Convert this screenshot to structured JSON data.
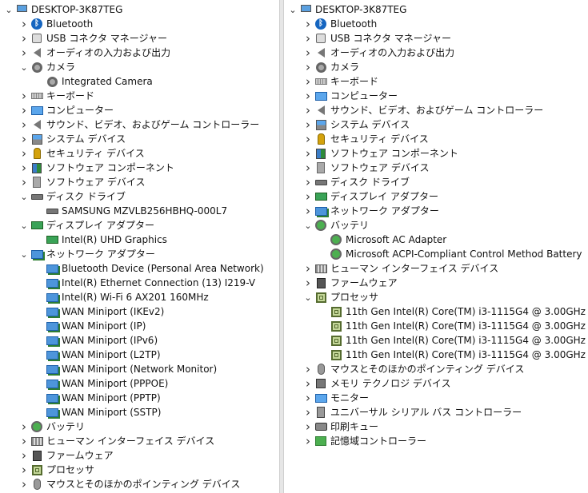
{
  "left": {
    "nodes": [
      {
        "label": "DESKTOP-3K87TEG",
        "depth": 0,
        "expander": "down",
        "icon": "computer-root-icon"
      },
      {
        "label": "Bluetooth",
        "depth": 1,
        "expander": "right",
        "icon": "bluetooth-icon"
      },
      {
        "label": "USB コネクタ マネージャー",
        "depth": 1,
        "expander": "right",
        "icon": "usb-connector-icon"
      },
      {
        "label": "オーディオの入力および出力",
        "depth": 1,
        "expander": "right",
        "icon": "speaker-icon"
      },
      {
        "label": "カメラ",
        "depth": 1,
        "expander": "down",
        "icon": "camera-icon"
      },
      {
        "label": "Integrated Camera",
        "depth": 2,
        "expander": "none",
        "icon": "camera-icon"
      },
      {
        "label": "キーボード",
        "depth": 1,
        "expander": "right",
        "icon": "keyboard-icon"
      },
      {
        "label": "コンピューター",
        "depth": 1,
        "expander": "right",
        "icon": "monitor-icon"
      },
      {
        "label": "サウンド、ビデオ、およびゲーム コントローラー",
        "depth": 1,
        "expander": "right",
        "icon": "speaker-icon"
      },
      {
        "label": "システム デバイス",
        "depth": 1,
        "expander": "right",
        "icon": "system-device-icon"
      },
      {
        "label": "セキュリティ デバイス",
        "depth": 1,
        "expander": "right",
        "icon": "security-key-icon"
      },
      {
        "label": "ソフトウェア コンポーネント",
        "depth": 1,
        "expander": "right",
        "icon": "software-component-icon"
      },
      {
        "label": "ソフトウェア デバイス",
        "depth": 1,
        "expander": "right",
        "icon": "software-device-icon"
      },
      {
        "label": "ディスク ドライブ",
        "depth": 1,
        "expander": "down",
        "icon": "disk-drive-icon"
      },
      {
        "label": "SAMSUNG MZVLB256HBHQ-000L7",
        "depth": 2,
        "expander": "none",
        "icon": "disk-drive-icon"
      },
      {
        "label": "ディスプレイ アダプター",
        "depth": 1,
        "expander": "down",
        "icon": "display-adapter-icon"
      },
      {
        "label": "Intel(R) UHD Graphics",
        "depth": 2,
        "expander": "none",
        "icon": "display-adapter-icon"
      },
      {
        "label": "ネットワーク アダプター",
        "depth": 1,
        "expander": "down",
        "icon": "network-adapter-icon"
      },
      {
        "label": "Bluetooth Device (Personal Area Network)",
        "depth": 2,
        "expander": "none",
        "icon": "network-adapter-icon"
      },
      {
        "label": "Intel(R) Ethernet Connection (13) I219-V",
        "depth": 2,
        "expander": "none",
        "icon": "network-adapter-icon"
      },
      {
        "label": "Intel(R) Wi-Fi 6 AX201 160MHz",
        "depth": 2,
        "expander": "none",
        "icon": "network-adapter-icon"
      },
      {
        "label": "WAN Miniport (IKEv2)",
        "depth": 2,
        "expander": "none",
        "icon": "network-adapter-icon"
      },
      {
        "label": "WAN Miniport (IP)",
        "depth": 2,
        "expander": "none",
        "icon": "network-adapter-icon"
      },
      {
        "label": "WAN Miniport (IPv6)",
        "depth": 2,
        "expander": "none",
        "icon": "network-adapter-icon"
      },
      {
        "label": "WAN Miniport (L2TP)",
        "depth": 2,
        "expander": "none",
        "icon": "network-adapter-icon"
      },
      {
        "label": "WAN Miniport (Network Monitor)",
        "depth": 2,
        "expander": "none",
        "icon": "network-adapter-icon"
      },
      {
        "label": "WAN Miniport (PPPOE)",
        "depth": 2,
        "expander": "none",
        "icon": "network-adapter-icon"
      },
      {
        "label": "WAN Miniport (PPTP)",
        "depth": 2,
        "expander": "none",
        "icon": "network-adapter-icon"
      },
      {
        "label": "WAN Miniport (SSTP)",
        "depth": 2,
        "expander": "none",
        "icon": "network-adapter-icon"
      },
      {
        "label": "バッテリ",
        "depth": 1,
        "expander": "right",
        "icon": "battery-icon"
      },
      {
        "label": "ヒューマン インターフェイス デバイス",
        "depth": 1,
        "expander": "right",
        "icon": "hid-icon"
      },
      {
        "label": "ファームウェア",
        "depth": 1,
        "expander": "right",
        "icon": "firmware-icon"
      },
      {
        "label": "プロセッサ",
        "depth": 1,
        "expander": "right",
        "icon": "processor-icon"
      },
      {
        "label": "マウスとそのほかのポインティング デバイス",
        "depth": 1,
        "expander": "right",
        "icon": "mouse-icon"
      }
    ]
  },
  "right": {
    "nodes": [
      {
        "label": "DESKTOP-3K87TEG",
        "depth": 0,
        "expander": "down",
        "icon": "computer-root-icon"
      },
      {
        "label": "Bluetooth",
        "depth": 1,
        "expander": "right",
        "icon": "bluetooth-icon"
      },
      {
        "label": "USB コネクタ マネージャー",
        "depth": 1,
        "expander": "right",
        "icon": "usb-connector-icon"
      },
      {
        "label": "オーディオの入力および出力",
        "depth": 1,
        "expander": "right",
        "icon": "speaker-icon"
      },
      {
        "label": "カメラ",
        "depth": 1,
        "expander": "right",
        "icon": "camera-icon"
      },
      {
        "label": "キーボード",
        "depth": 1,
        "expander": "right",
        "icon": "keyboard-icon"
      },
      {
        "label": "コンピューター",
        "depth": 1,
        "expander": "right",
        "icon": "monitor-icon"
      },
      {
        "label": "サウンド、ビデオ、およびゲーム コントローラー",
        "depth": 1,
        "expander": "right",
        "icon": "speaker-icon"
      },
      {
        "label": "システム デバイス",
        "depth": 1,
        "expander": "right",
        "icon": "system-device-icon"
      },
      {
        "label": "セキュリティ デバイス",
        "depth": 1,
        "expander": "right",
        "icon": "security-key-icon"
      },
      {
        "label": "ソフトウェア コンポーネント",
        "depth": 1,
        "expander": "right",
        "icon": "software-component-icon"
      },
      {
        "label": "ソフトウェア デバイス",
        "depth": 1,
        "expander": "right",
        "icon": "software-device-icon"
      },
      {
        "label": "ディスク ドライブ",
        "depth": 1,
        "expander": "right",
        "icon": "disk-drive-icon"
      },
      {
        "label": "ディスプレイ アダプター",
        "depth": 1,
        "expander": "right",
        "icon": "display-adapter-icon"
      },
      {
        "label": "ネットワーク アダプター",
        "depth": 1,
        "expander": "right",
        "icon": "network-adapter-icon"
      },
      {
        "label": "バッテリ",
        "depth": 1,
        "expander": "down",
        "icon": "battery-icon"
      },
      {
        "label": "Microsoft AC Adapter",
        "depth": 2,
        "expander": "none",
        "icon": "battery-icon"
      },
      {
        "label": "Microsoft ACPI-Compliant Control Method Battery",
        "depth": 2,
        "expander": "none",
        "icon": "battery-icon"
      },
      {
        "label": "ヒューマン インターフェイス デバイス",
        "depth": 1,
        "expander": "right",
        "icon": "hid-icon"
      },
      {
        "label": "ファームウェア",
        "depth": 1,
        "expander": "right",
        "icon": "firmware-icon"
      },
      {
        "label": "プロセッサ",
        "depth": 1,
        "expander": "down",
        "icon": "processor-icon"
      },
      {
        "label": "11th Gen Intel(R) Core(TM) i3-1115G4 @ 3.00GHz",
        "depth": 2,
        "expander": "none",
        "icon": "processor-icon"
      },
      {
        "label": "11th Gen Intel(R) Core(TM) i3-1115G4 @ 3.00GHz",
        "depth": 2,
        "expander": "none",
        "icon": "processor-icon"
      },
      {
        "label": "11th Gen Intel(R) Core(TM) i3-1115G4 @ 3.00GHz",
        "depth": 2,
        "expander": "none",
        "icon": "processor-icon"
      },
      {
        "label": "11th Gen Intel(R) Core(TM) i3-1115G4 @ 3.00GHz",
        "depth": 2,
        "expander": "none",
        "icon": "processor-icon"
      },
      {
        "label": "マウスとそのほかのポインティング デバイス",
        "depth": 1,
        "expander": "right",
        "icon": "mouse-icon"
      },
      {
        "label": "メモリ テクノロジ デバイス",
        "depth": 1,
        "expander": "right",
        "icon": "memory-technology-icon"
      },
      {
        "label": "モニター",
        "depth": 1,
        "expander": "right",
        "icon": "monitor-icon"
      },
      {
        "label": "ユニバーサル シリアル バス コントローラー",
        "depth": 1,
        "expander": "right",
        "icon": "usb-controller-icon"
      },
      {
        "label": "印刷キュー",
        "depth": 1,
        "expander": "right",
        "icon": "printer-icon"
      },
      {
        "label": "記憶域コントローラー",
        "depth": 1,
        "expander": "right",
        "icon": "storage-controller-icon"
      }
    ]
  }
}
